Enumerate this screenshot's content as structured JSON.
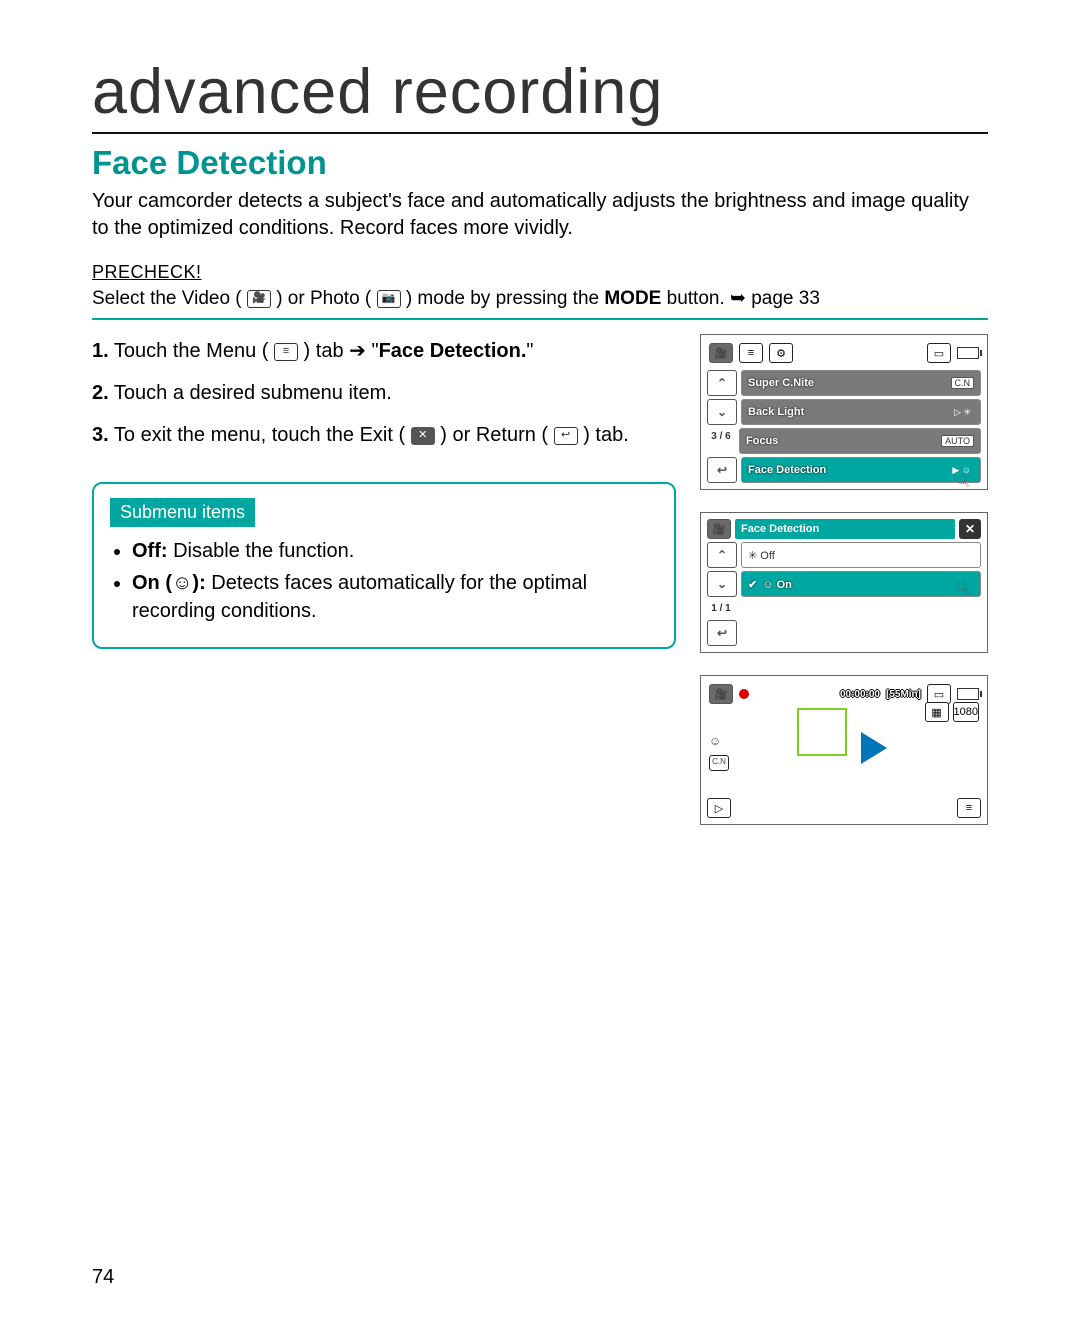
{
  "chapter_title": "advanced recording",
  "section_title": "Face Detection",
  "intro": "Your camcorder detects a subject's face and automatically adjusts the brightness and image quality to the optimized conditions. Record faces more vividly.",
  "precheck_label": "PRECHECK!",
  "precheck": {
    "prefix": "Select the Video (",
    "mid1": ") or Photo (",
    "mid2": ") mode by pressing the ",
    "mode_word": "MODE",
    "suffix": " button. ",
    "page_ref": "page 33"
  },
  "steps": [
    {
      "n": "1.",
      "pre": "Touch the Menu (",
      "mid": ") tab ",
      "arrow": "➔",
      "q1": "\"",
      "bold": "Face Detection.",
      "q2": "\""
    },
    {
      "n": "2.",
      "text": "Touch a desired submenu item."
    },
    {
      "n": "3.",
      "pre": "To exit the menu, touch the Exit (",
      "mid": ") or Return (",
      "suf": ") tab."
    }
  ],
  "submenu": {
    "head": "Submenu items",
    "off_label": "Off:",
    "off_text": " Disable the function.",
    "on_label": "On (",
    "on_label2": "):",
    "on_text": " Detects faces automatically for the optimal recording conditions."
  },
  "screen1": {
    "items": [
      "Super C.Nite",
      "Back Light",
      "Focus",
      "Face Detection"
    ],
    "right_tags": [
      "C.N",
      "",
      "AUTO",
      ""
    ],
    "page": "3 / 6"
  },
  "screen2": {
    "title": "Face Detection",
    "off": "Off",
    "on": "On",
    "page": "1 / 1"
  },
  "screen3": {
    "time": "00:00:00",
    "remain": "[55Min]",
    "res": "1080"
  },
  "page_number": "74"
}
